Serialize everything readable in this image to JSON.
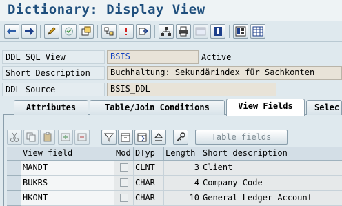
{
  "title": "Dictionary: Display View",
  "toolbar": {
    "icons": [
      "back-icon",
      "forward-icon",
      "edit-icon",
      "activate-icon",
      "other-object-icon",
      "where-used-icon",
      "check-icon",
      "navigate-icon",
      "hierarchy-icon",
      "print-icon",
      "window-icon",
      "info-icon",
      "layout-icon",
      "grid-icon"
    ]
  },
  "header": {
    "ddl_sql_view_label": "DDL SQL View",
    "ddl_sql_view_value": "BSIS",
    "status": "Active",
    "short_description_label": "Short Description",
    "short_description_value": "Buchhaltung: Sekundärindex für Sachkonten",
    "ddl_source_label": "DDL Source",
    "ddl_source_value": "BSIS_DDL"
  },
  "tabs": [
    {
      "label": "Attributes",
      "active": false
    },
    {
      "label": "Table/Join Conditions",
      "active": false
    },
    {
      "label": "View Fields",
      "active": true
    },
    {
      "label": "Selec",
      "active": false
    }
  ],
  "panel": {
    "table_fields_button": "Table fields"
  },
  "grid": {
    "columns": [
      "View field",
      "Mod",
      "DTyp",
      "Length",
      "Short description"
    ],
    "rows": [
      {
        "field": "MANDT",
        "dtyp": "CLNT",
        "length": "3",
        "desc": "Client"
      },
      {
        "field": "BUKRS",
        "dtyp": "CHAR",
        "length": "4",
        "desc": "Company Code"
      },
      {
        "field": "HKONT",
        "dtyp": "CHAR",
        "length": "10",
        "desc": "General Ledger Account"
      }
    ]
  },
  "colors": {
    "title": "#1f4f7d",
    "link": "#1040c0",
    "background": "#dfe9ee"
  }
}
